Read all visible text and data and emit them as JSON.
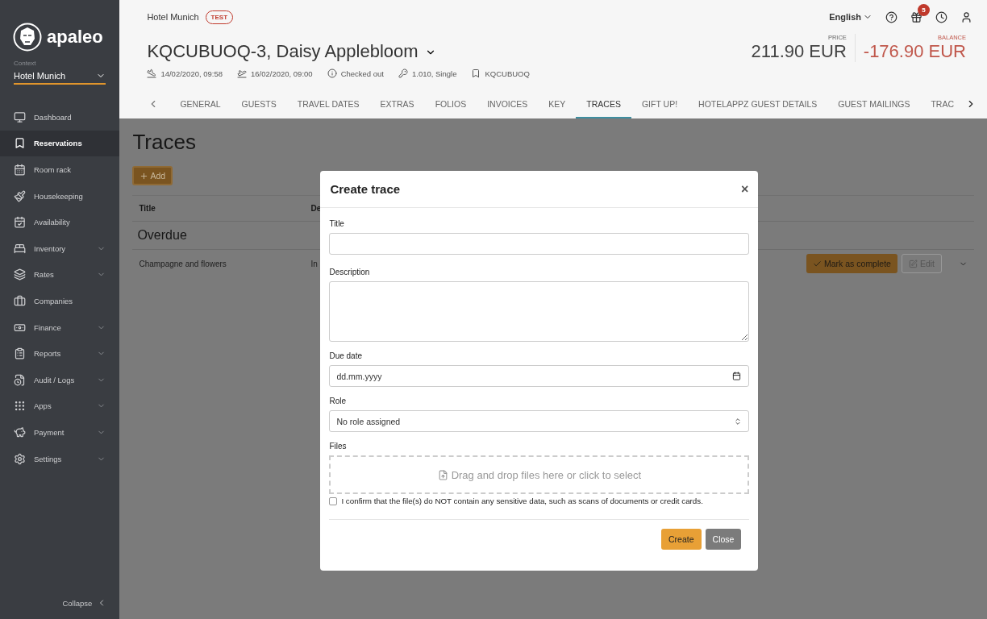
{
  "sidebar": {
    "logo": "apaleo",
    "context_label": "Context",
    "context_value": "Hotel Munich",
    "items": [
      {
        "label": "Dashboard",
        "kind": "dashboard",
        "selected": false,
        "has_submenu": false
      },
      {
        "label": "Reservations",
        "kind": "reservations",
        "selected": true,
        "has_submenu": false
      },
      {
        "label": "Room rack",
        "kind": "calendar",
        "selected": false,
        "has_submenu": false
      },
      {
        "label": "Housekeeping",
        "kind": "broom",
        "selected": false,
        "has_submenu": false
      },
      {
        "label": "Availability",
        "kind": "check",
        "selected": false,
        "has_submenu": false
      },
      {
        "label": "Inventory",
        "kind": "bed",
        "selected": false,
        "has_submenu": true
      },
      {
        "label": "Rates",
        "kind": "layers",
        "selected": false,
        "has_submenu": true
      },
      {
        "label": "Companies",
        "kind": "briefcase",
        "selected": false,
        "has_submenu": false
      },
      {
        "label": "Finance",
        "kind": "money",
        "selected": false,
        "has_submenu": true
      },
      {
        "label": "Reports",
        "kind": "clipboard",
        "selected": false,
        "has_submenu": true
      },
      {
        "label": "Audit / Logs",
        "kind": "audit",
        "selected": false,
        "has_submenu": true
      },
      {
        "label": "Apps",
        "kind": "grid",
        "selected": false,
        "has_submenu": true
      },
      {
        "label": "Payment",
        "kind": "piggy",
        "selected": false,
        "has_submenu": true
      },
      {
        "label": "Settings",
        "kind": "settings",
        "selected": false,
        "has_submenu": true
      }
    ],
    "collapse": "Collapse"
  },
  "header": {
    "property": "Hotel Munich",
    "badge": "TEST",
    "language": "English",
    "notifications": "5",
    "reservation_title": "KQCUBUOQ-3, Daisy Applebloom",
    "price_label": "PRICE",
    "price": "211.90 EUR",
    "balance_label": "BALANCE",
    "balance": "-176.90 EUR",
    "info": [
      {
        "kind": "arrival",
        "text": "14/02/2020, 09:58"
      },
      {
        "kind": "departure",
        "text": "16/02/2020, 09:00"
      },
      {
        "kind": "status",
        "text": "Checked out"
      },
      {
        "kind": "unit",
        "text": "1.010, Single"
      },
      {
        "kind": "booking",
        "text": "KQCUBUOQ"
      }
    ],
    "tabs": [
      {
        "label": "GENERAL",
        "selected": false
      },
      {
        "label": "GUESTS",
        "selected": false
      },
      {
        "label": "TRAVEL DATES",
        "selected": false
      },
      {
        "label": "EXTRAS",
        "selected": false
      },
      {
        "label": "FOLIOS",
        "selected": false
      },
      {
        "label": "INVOICES",
        "selected": false
      },
      {
        "label": "KEY",
        "selected": false
      },
      {
        "label": "TRACES",
        "selected": true
      },
      {
        "label": "GIFT UP!",
        "selected": false
      },
      {
        "label": "HOTELAPPZ GUEST DETAILS",
        "selected": false
      },
      {
        "label": "GUEST MAILINGS",
        "selected": false
      },
      {
        "label": "TRAC",
        "selected": false
      }
    ]
  },
  "page": {
    "title": "Traces",
    "add_button": "Add",
    "columns": [
      "Title",
      "De"
    ],
    "group": "Overdue",
    "rows": [
      {
        "title": "Champagne and flowers",
        "column_2": "In",
        "complete_button": "Mark as complete",
        "edit_button": "Edit"
      }
    ]
  },
  "dialog": {
    "title": "Create trace",
    "close_icon": "×",
    "title_label": "Title",
    "description_label": "Description",
    "due_date_label": "Due date",
    "due_date": {
      "placeholder": "dd.mm.yyyy"
    },
    "role_label": "Role",
    "role": "No role assigned",
    "files_label": "Files",
    "dropzone": "Drag and drop files here or click to select",
    "confirm": {
      "text": "I confirm that the file(s) do NOT contain any sensitive data, such as scans of documents or credit cards.",
      "checked": false
    },
    "buttons": [
      {
        "kind": "primary",
        "label": "Create"
      },
      {
        "kind": "secondary",
        "label": "Close"
      }
    ]
  }
}
